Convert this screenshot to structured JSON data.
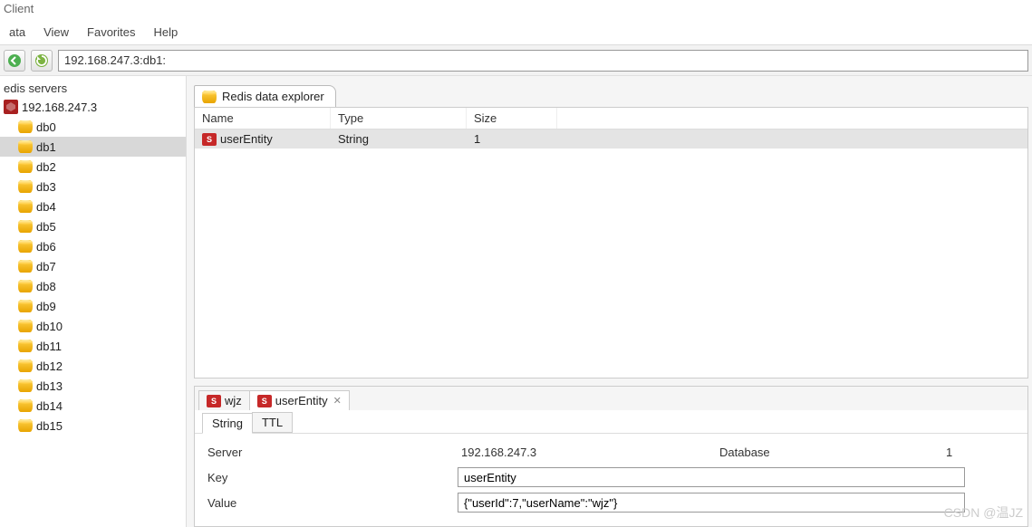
{
  "window": {
    "title": "Client"
  },
  "menu": {
    "data": "ata",
    "view": "View",
    "favorites": "Favorites",
    "help": "Help"
  },
  "toolbar": {
    "address": "192.168.247.3:db1:"
  },
  "sidebar": {
    "heading": "edis servers",
    "server": "192.168.247.3",
    "dbs": [
      "db0",
      "db1",
      "db2",
      "db3",
      "db4",
      "db5",
      "db6",
      "db7",
      "db8",
      "db9",
      "db10",
      "db11",
      "db12",
      "db13",
      "db14",
      "db15"
    ],
    "selected": "db1"
  },
  "explorer": {
    "tab_label": "Redis data explorer",
    "columns": {
      "name": "Name",
      "type": "Type",
      "size": "Size"
    },
    "rows": [
      {
        "name": "userEntity",
        "type": "String",
        "size": "1"
      }
    ]
  },
  "detail": {
    "tabs": [
      {
        "label": "wjz",
        "active": false
      },
      {
        "label": "userEntity",
        "active": true
      }
    ],
    "subtabs": {
      "string": "String",
      "ttl": "TTL"
    },
    "fields": {
      "server_label": "Server",
      "server_value": "192.168.247.3",
      "database_label": "Database",
      "database_value": "1",
      "key_label": "Key",
      "key_value": "userEntity",
      "value_label": "Value",
      "value_value": "{\"userId\":7,\"userName\":\"wjz\"}"
    }
  },
  "watermark": "CSDN @温JZ"
}
